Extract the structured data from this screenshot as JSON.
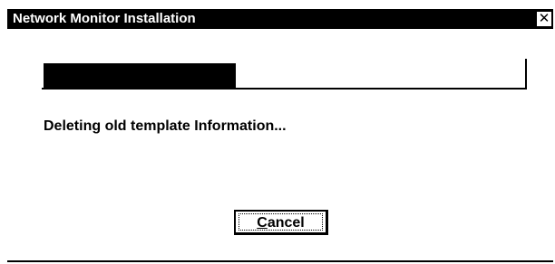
{
  "window": {
    "title": "Network Monitor Installation",
    "close_glyph": "✕"
  },
  "progress": {
    "fraction": 0.4,
    "fill_color": "#000000"
  },
  "status": {
    "text": "Deleting old template Information..."
  },
  "buttons": {
    "cancel_label": "Cancel",
    "cancel_mnemonic": "C",
    "cancel_rest": "ancel"
  }
}
